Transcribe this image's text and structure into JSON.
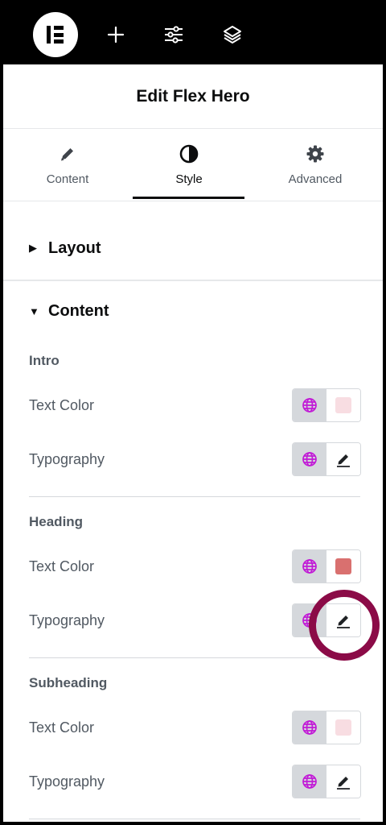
{
  "topbar": {
    "icons": [
      "elementor-logo-icon",
      "plus-icon",
      "sliders-icon",
      "layers-icon"
    ]
  },
  "header": {
    "title": "Edit Flex Hero"
  },
  "tabs": [
    {
      "label": "Content",
      "icon": "pencil-icon",
      "active": false
    },
    {
      "label": "Style",
      "icon": "half-circle-icon",
      "active": true
    },
    {
      "label": "Advanced",
      "icon": "gear-icon",
      "active": false
    }
  ],
  "sections": {
    "layout": {
      "title": "Layout",
      "expanded": false
    },
    "content": {
      "title": "Content",
      "expanded": true
    }
  },
  "groups": {
    "intro": {
      "title": "Intro",
      "text_color_label": "Text Color",
      "typography_label": "Typography",
      "color": "#f8dde2"
    },
    "heading": {
      "title": "Heading",
      "text_color_label": "Text Color",
      "typography_label": "Typography",
      "color": "#d9706f"
    },
    "subheading": {
      "title": "Subheading",
      "text_color_label": "Text Color",
      "typography_label": "Typography",
      "color": "#f8dde2"
    }
  },
  "colors": {
    "accent_global": "#c11ad6",
    "highlight_ring": "#8b0b47"
  }
}
